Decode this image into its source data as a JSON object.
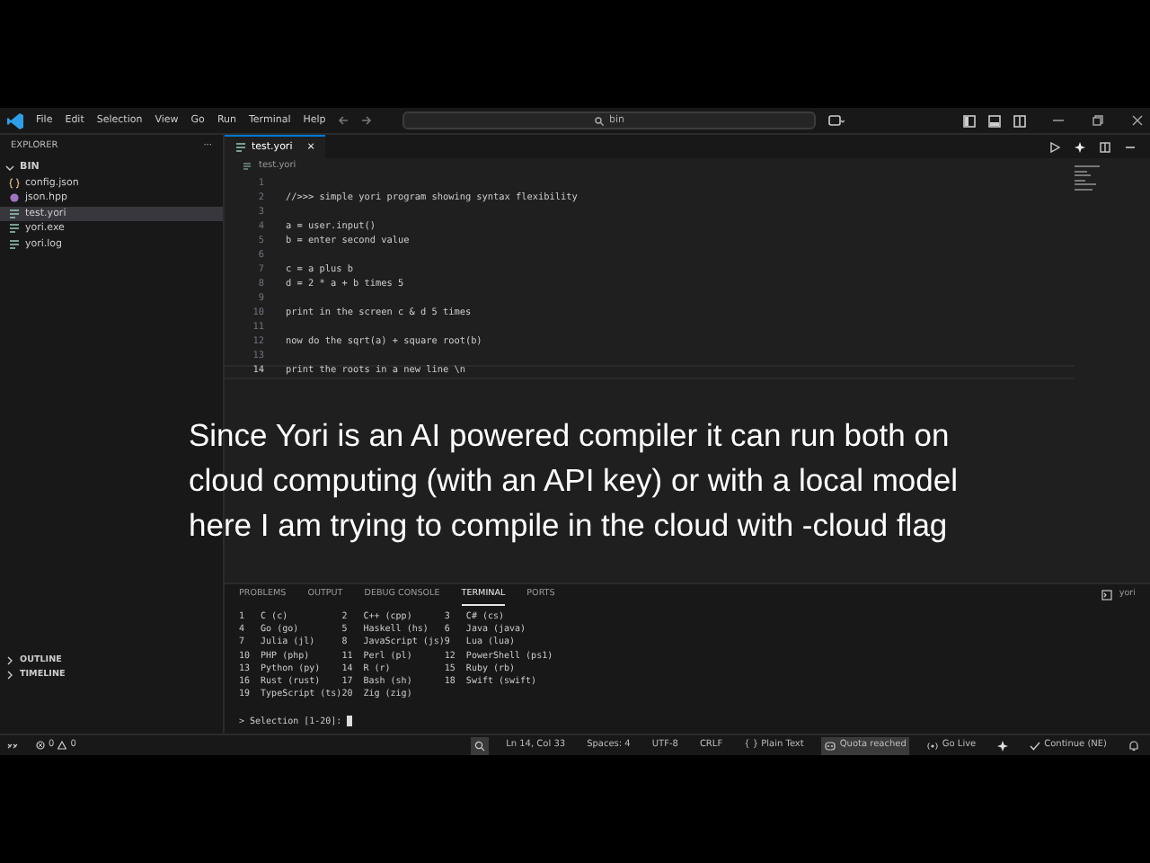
{
  "title_bar": {
    "menu": [
      "File",
      "Edit",
      "Selection",
      "View",
      "Go",
      "Run",
      "Terminal",
      "Help"
    ],
    "search": {
      "value": "bin"
    }
  },
  "sidebar": {
    "title": "EXPLORER",
    "more": "···",
    "folder": {
      "label": "BIN",
      "expanded": true,
      "children": [
        {
          "label": "config.json",
          "kind": "json",
          "selected": false
        },
        {
          "label": "json.hpp",
          "kind": "cpp",
          "selected": false
        },
        {
          "label": "test.yori",
          "kind": "text",
          "selected": true
        },
        {
          "label": "yori.exe",
          "kind": "text",
          "selected": false
        },
        {
          "label": "yori.log",
          "kind": "text",
          "selected": false
        }
      ]
    },
    "sections": [
      {
        "label": "OUTLINE",
        "expanded": false
      },
      {
        "label": "TIMELINE",
        "expanded": false
      }
    ]
  },
  "editor": {
    "tabs": [
      {
        "label": "test.yori",
        "selected": true,
        "close": "×"
      }
    ],
    "breadcrumb": "test.yori",
    "lines": [
      {
        "number": "1",
        "current": false
      },
      {
        "number": "2",
        "text": "//>>> simple yori program showing syntax flexibility",
        "current": false
      },
      {
        "number": "3",
        "current": false
      },
      {
        "number": "4",
        "text": "a = user.input()",
        "current": false
      },
      {
        "number": "5",
        "text": "b = enter second value",
        "current": false
      },
      {
        "number": "6",
        "current": false
      },
      {
        "number": "7",
        "text": "c = a plus b",
        "current": false
      },
      {
        "number": "8",
        "text": "d = 2 * a + b times 5",
        "current": false
      },
      {
        "number": "9",
        "current": false
      },
      {
        "number": "10",
        "text": "print in the screen c & d 5 times",
        "current": false
      },
      {
        "number": "11",
        "current": false
      },
      {
        "number": "12",
        "text": "now do the sqrt(a) + square root(b)",
        "current": false
      },
      {
        "number": "13",
        "current": false
      },
      {
        "number": "14",
        "text": "print the roots in a new line \\n",
        "current": true
      }
    ]
  },
  "caption": {
    "lines": [
      "Since Yori is an AI powered compiler it can run both on",
      "cloud computing (with an API key) or with a local model",
      "here I am trying to compile in the cloud with -cloud flag"
    ]
  },
  "panel": {
    "tabs": [
      {
        "label": "PROBLEMS",
        "selected": false
      },
      {
        "label": "OUTPUT",
        "selected": false
      },
      {
        "label": "DEBUG CONSOLE",
        "selected": false
      },
      {
        "label": "TERMINAL",
        "selected": true
      },
      {
        "label": "PORTS",
        "selected": false
      }
    ],
    "terminal_title": "yori",
    "terminal_lines": [
      "1   C (c)          2   C++ (cpp)      3   C# (cs)",
      "4   Go (go)        5   Haskell (hs)   6   Java (java)",
      "7   Julia (jl)     8   JavaScript (js)9   Lua (lua)",
      "10  PHP (php)      11  Perl (pl)      12  PowerShell (ps1)",
      "13  Python (py)    14  R (r)          15  Ruby (rb)",
      "16  Rust (rust)    17  Bash (sh)      18  Swift (swift)",
      "19  TypeScript (ts)20  Zig (zig)"
    ],
    "prompt": "> Selection [1-20]: "
  },
  "status_bar": {
    "errors": "0",
    "warnings": "0",
    "items": [
      {
        "kind": "zoom"
      },
      {
        "kind": "text",
        "label": "Ln 14, Col 33"
      },
      {
        "kind": "text",
        "label": "Spaces: 4"
      },
      {
        "kind": "text",
        "label": "UTF-8"
      },
      {
        "kind": "text",
        "label": "CRLF"
      },
      {
        "kind": "text",
        "label": "{ } Plain Text"
      },
      {
        "kind": "quota",
        "label": "Quota reached"
      },
      {
        "kind": "live",
        "label": "Go Live"
      },
      {
        "kind": "copilot"
      },
      {
        "kind": "check",
        "label": "Continue (NE)"
      },
      {
        "kind": "bell"
      }
    ]
  }
}
